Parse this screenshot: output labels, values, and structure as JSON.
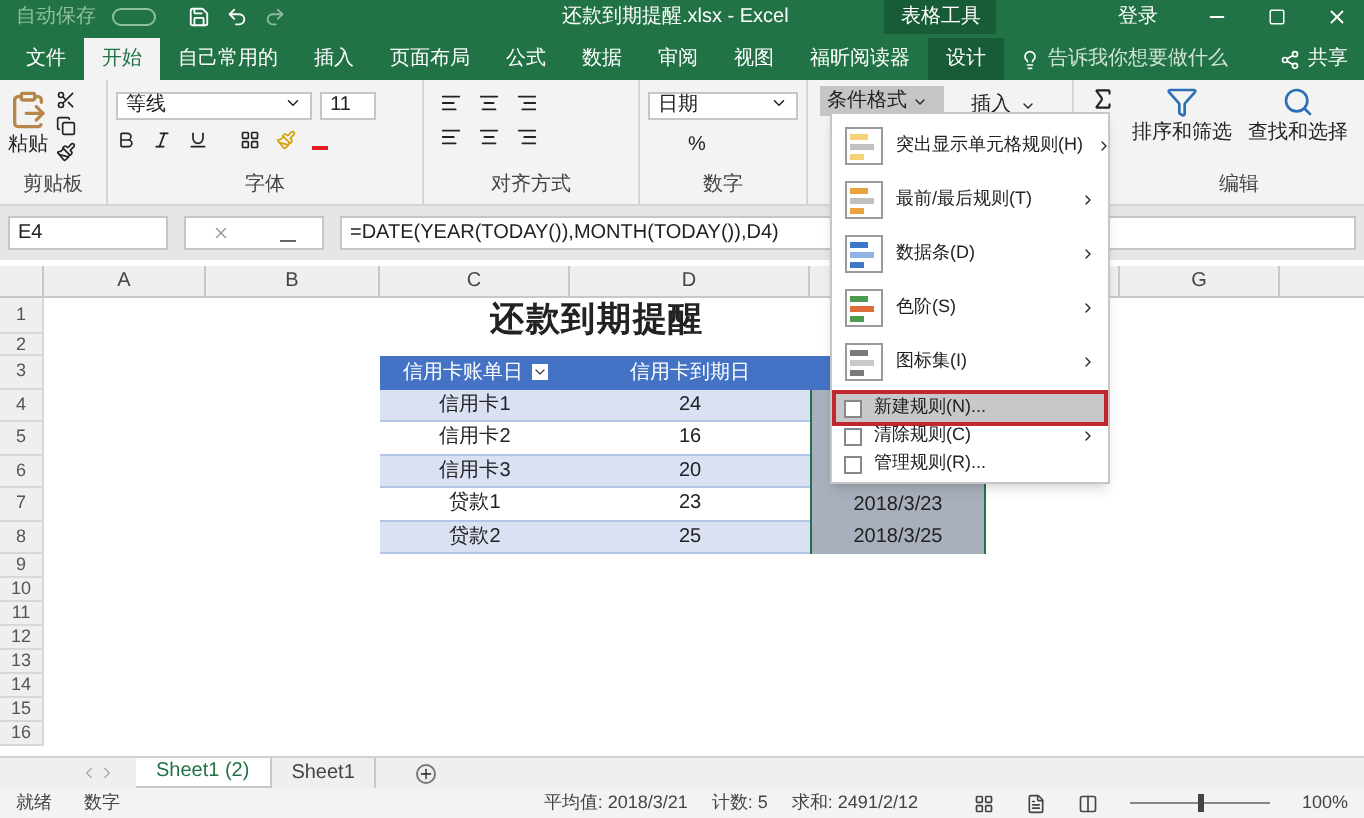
{
  "title_bar": {
    "autosave": "自动保存",
    "autosave_on": false,
    "filename": "还款到期提醒.xlsx - Excel",
    "context_group": "表格工具",
    "sign_in": "登录"
  },
  "ribbon_tabs": [
    {
      "label": "文件",
      "selected": false,
      "kind": "normal"
    },
    {
      "label": "开始",
      "selected": true,
      "kind": "normal"
    },
    {
      "label": "自己常用的",
      "selected": false,
      "kind": "normal"
    },
    {
      "label": "插入",
      "selected": false,
      "kind": "normal"
    },
    {
      "label": "页面布局",
      "selected": false,
      "kind": "normal"
    },
    {
      "label": "公式",
      "selected": false,
      "kind": "normal"
    },
    {
      "label": "数据",
      "selected": false,
      "kind": "normal"
    },
    {
      "label": "审阅",
      "selected": false,
      "kind": "normal"
    },
    {
      "label": "视图",
      "selected": false,
      "kind": "normal"
    },
    {
      "label": "福昕阅读器",
      "selected": false,
      "kind": "normal"
    },
    {
      "label": "设计",
      "selected": false,
      "kind": "context"
    }
  ],
  "tell_me": {
    "placeholder": "告诉我你想要做什么"
  },
  "share": "共享",
  "ribbon": {
    "clipboard": {
      "paste": "粘贴",
      "label": "剪贴板"
    },
    "font": {
      "font_name": "等线",
      "font_size": "11",
      "label": "字体"
    },
    "alignment": {
      "label": "对齐方式"
    },
    "number": {
      "format": "日期",
      "percent": "%",
      "label": "数字"
    },
    "styles": {
      "conditional_formatting": "条件格式"
    },
    "cells": {
      "insert": "插入"
    },
    "editing": {
      "sort_filter": "排序和筛选",
      "find_select": "查找和选择",
      "label": "编辑"
    }
  },
  "formula_bar": {
    "name_box": "E4",
    "formula": "=DATE(YEAR(TODAY()),MONTH(TODAY()),D4)"
  },
  "columns": [
    {
      "label": "A"
    },
    {
      "label": "B"
    },
    {
      "label": "C"
    },
    {
      "label": "D"
    },
    {},
    {},
    {
      "label": "G"
    },
    {}
  ],
  "row_numbers": [
    "1",
    "2",
    "3",
    "4",
    "5",
    "6",
    "7",
    "8",
    "9",
    "10",
    "11",
    "12",
    "13",
    "14",
    "15",
    "16"
  ],
  "sheet_title": "还款到期提醒",
  "table": {
    "headers": [
      "信用卡账单日",
      "信用卡到期日"
    ],
    "rows": [
      {
        "name": "信用卡1",
        "day": "24"
      },
      {
        "name": "信用卡2",
        "day": "16"
      },
      {
        "name": "信用卡3",
        "day": "20"
      },
      {
        "name": "贷款1",
        "day": "23",
        "due": "2018/3/23"
      },
      {
        "name": "贷款2",
        "day": "25",
        "due": "2018/3/25"
      }
    ]
  },
  "cf_menu": [
    {
      "label": "突出显示单元格规则(H)",
      "kind": "large",
      "submenu": true,
      "selected": false
    },
    {
      "label": "最前/最后规则(T)",
      "kind": "large",
      "submenu": true,
      "selected": false
    },
    {
      "label": "数据条(D)",
      "kind": "large",
      "submenu": true,
      "selected": false
    },
    {
      "label": "色阶(S)",
      "kind": "large",
      "submenu": true,
      "selected": false
    },
    {
      "label": "图标集(I)",
      "kind": "large",
      "submenu": true,
      "selected": false
    },
    {
      "label": "新建规则(N)...",
      "kind": "small",
      "submenu": false,
      "selected": true
    },
    {
      "label": "清除规则(C)",
      "kind": "small",
      "submenu": true,
      "selected": false
    },
    {
      "label": "管理规则(R)...",
      "kind": "small",
      "submenu": false,
      "selected": false
    }
  ],
  "sheet_tabs": [
    {
      "label": "Sheet1 (2)",
      "selected": true
    },
    {
      "label": "Sheet1",
      "selected": false
    }
  ],
  "status_bar": {
    "ready": "就绪",
    "mode": "数字",
    "stats": [
      "平均值: 2018/3/21",
      "计数: 5",
      "求和: 2491/2/12"
    ],
    "zoom": "100%",
    "zoom_slider": {
      "level": 0.5
    }
  }
}
